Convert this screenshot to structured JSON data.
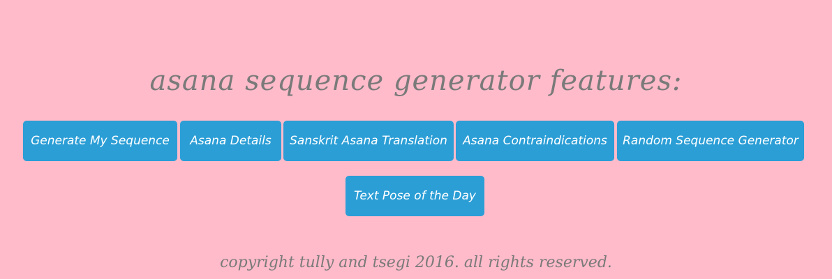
{
  "title": "asana sequence generator features:",
  "buttons": [
    {
      "label": "Generate My Sequence"
    },
    {
      "label": "Asana Details"
    },
    {
      "label": "Sanskrit Asana Translation"
    },
    {
      "label": "Asana Contraindications"
    },
    {
      "label": "Random Sequence Generator"
    },
    {
      "label": "Text Pose of the Day"
    }
  ],
  "footer": {
    "copyright": "copyright tully and tsegi 2016. all rights reserved."
  },
  "colors": {
    "background": "#ffbbca",
    "button": "#2b9ed6",
    "text": "#7a7a7a"
  }
}
